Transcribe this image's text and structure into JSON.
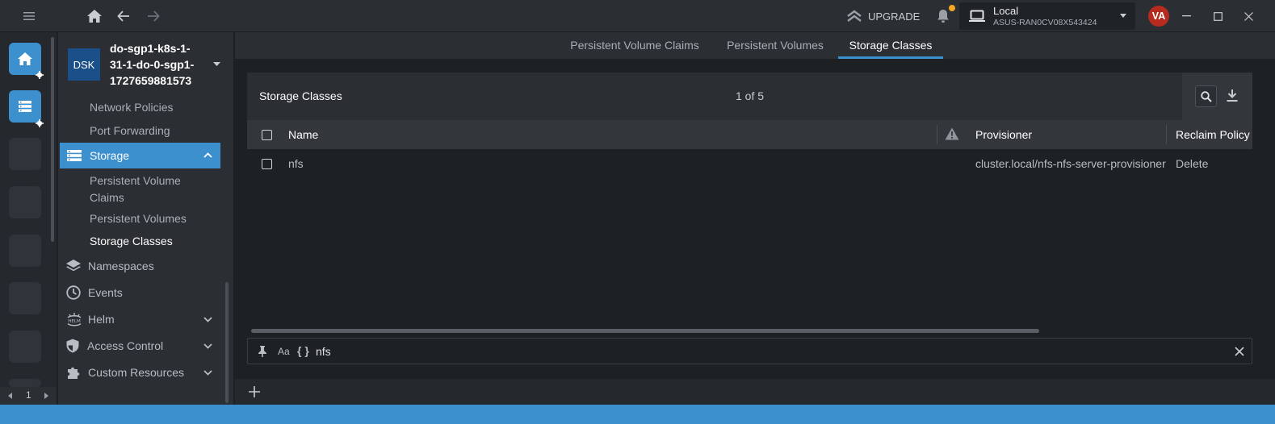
{
  "topbar": {
    "upgrade_label": "UPGRADE",
    "cluster_name": "Local",
    "cluster_host": "ASUS-RAN0CV08X543424",
    "avatar_initials": "VA",
    "notification_dot_color": "#f5a623"
  },
  "hotbar": {
    "page_number": "1"
  },
  "sidebar": {
    "cluster_badge": "DSK",
    "cluster_title_lines": [
      "do-sgp1-k8s-1-",
      "31-1-do-0-sgp1-",
      "1727659881573"
    ],
    "items": {
      "network_policies": "Network Policies",
      "port_forwarding": "Port Forwarding",
      "storage": "Storage",
      "pvc_line1": "Persistent Volume",
      "pvc_line2": "Claims",
      "persistent_volumes": "Persistent Volumes",
      "storage_classes": "Storage Classes",
      "namespaces": "Namespaces",
      "events": "Events",
      "helm": "Helm",
      "access_control": "Access Control",
      "custom_resources": "Custom Resources"
    }
  },
  "tabs": [
    {
      "label": "Persistent Volume Claims",
      "active": false
    },
    {
      "label": "Persistent Volumes",
      "active": false
    },
    {
      "label": "Storage Classes",
      "active": true
    }
  ],
  "panel": {
    "title": "Storage Classes",
    "count": "1 of 5",
    "columns": {
      "name": "Name",
      "provisioner": "Provisioner",
      "reclaim_policy": "Reclaim Policy"
    },
    "rows": [
      {
        "name": "nfs",
        "provisioner": "cluster.local/nfs-nfs-server-provisioner",
        "reclaim_policy": "Delete"
      }
    ]
  },
  "search": {
    "value": "nfs"
  },
  "colors": {
    "accent": "#3d90ce",
    "avatar": "#b52b1f"
  }
}
